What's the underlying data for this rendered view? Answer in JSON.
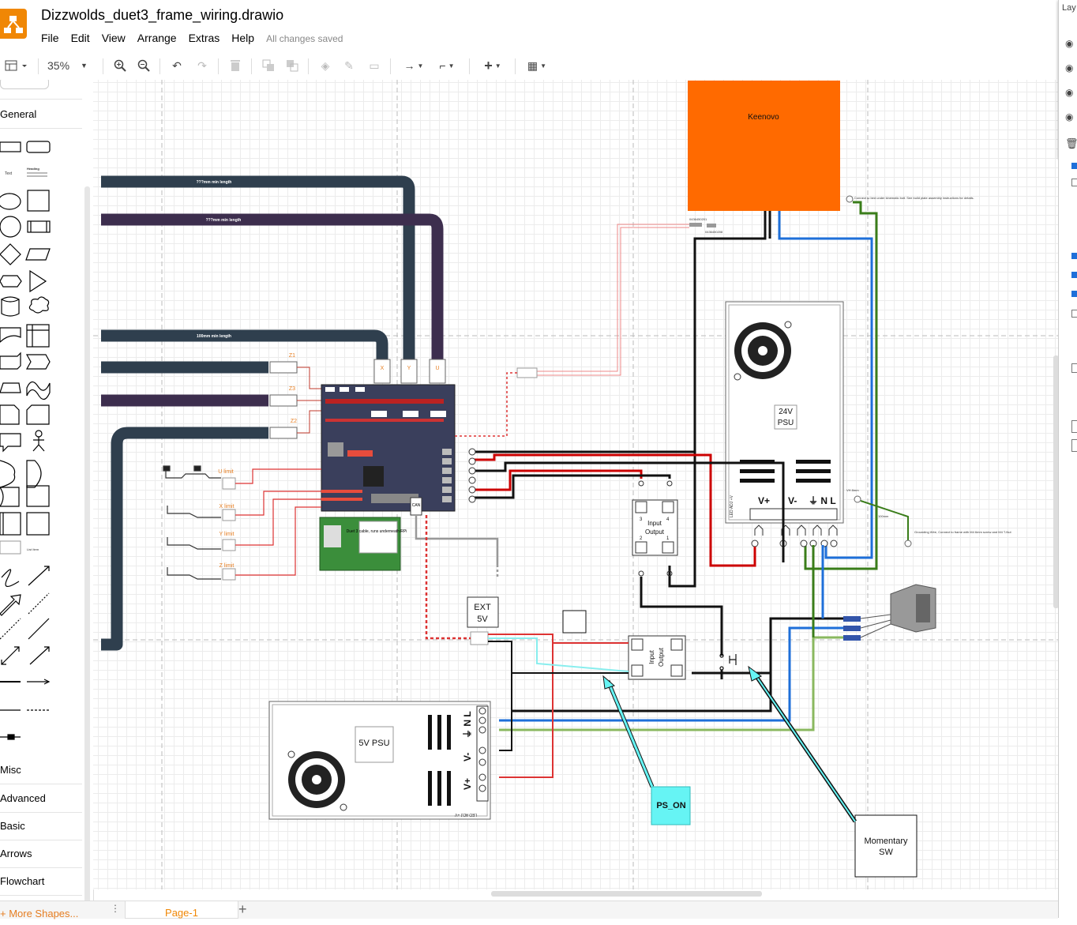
{
  "app": {
    "title": "Dizzwolds_duet3_frame_wiring.drawio",
    "save_status": "All changes saved",
    "menu": [
      "File",
      "Edit",
      "View",
      "Arrange",
      "Extras",
      "Help"
    ]
  },
  "toolbar": {
    "zoom": "35%",
    "icons": [
      "format-panel-icon",
      "zoom-in-icon",
      "zoom-out-icon",
      "undo-icon",
      "redo-icon",
      "delete-icon",
      "to-front-icon",
      "to-back-icon",
      "fill-color-icon",
      "line-color-icon",
      "shadow-icon",
      "connection-icon",
      "waypoints-icon",
      "insert-icon",
      "table-icon"
    ]
  },
  "sidebar": {
    "sections": [
      "General",
      "Misc",
      "Advanced",
      "Basic",
      "Arrows",
      "Flowchart"
    ],
    "shape_text": "Text",
    "shape_heading": "Heading",
    "shape_list": "List Item",
    "more_shapes": "+ More Shapes..."
  },
  "pages": {
    "tabs": [
      "Page-1"
    ]
  },
  "layers_panel": {
    "title": "Lay"
  },
  "diagram": {
    "cables": [
      "???mm min length",
      "???mm min length",
      "100mm min length"
    ],
    "heater": "Keenovo",
    "heater_note": "Connect to bed under kinematic bolt. See build plate assembly instructions for details.",
    "heater_part_a": "0436450201",
    "heater_part_b": "0436450208",
    "psu24": {
      "line1": "24V",
      "line2": "PSU",
      "v_plus": "V+",
      "v_minus": "V-",
      "gnd_nl": "⏚ N L",
      "adj": "LED ADJ +V"
    },
    "psu5": {
      "label": "5V PSU",
      "v_plus": "V+",
      "v_minus": "V-",
      "gnd_nl": "⏚ N L",
      "adj": "LED ADJ +V"
    },
    "ssr_labels": {
      "input": "Input",
      "output": "Output",
      "t1": "1",
      "t2": "2",
      "t3": "3",
      "t4": "4"
    },
    "axes": [
      "X",
      "Y",
      "U"
    ],
    "z_motors": [
      "Z1",
      "Z3",
      "Z2"
    ],
    "limits": [
      "U limit",
      "X limit",
      "Y limit",
      "Z limit"
    ],
    "rpi": "Duet 3 cable, runs underneath RPi",
    "can": "CAN",
    "ext5v": {
      "line1": "EXT",
      "line2": "5V"
    },
    "ps_on": "PS_ON",
    "switch": {
      "line1": "Momentary",
      "line2": "SW"
    },
    "ground_note": "Grounding Wire, Connect to frame with M4 6mm screw and M4 T-Nut",
    "len_100": "100mm",
    "vh_note": "VH 8mm"
  }
}
